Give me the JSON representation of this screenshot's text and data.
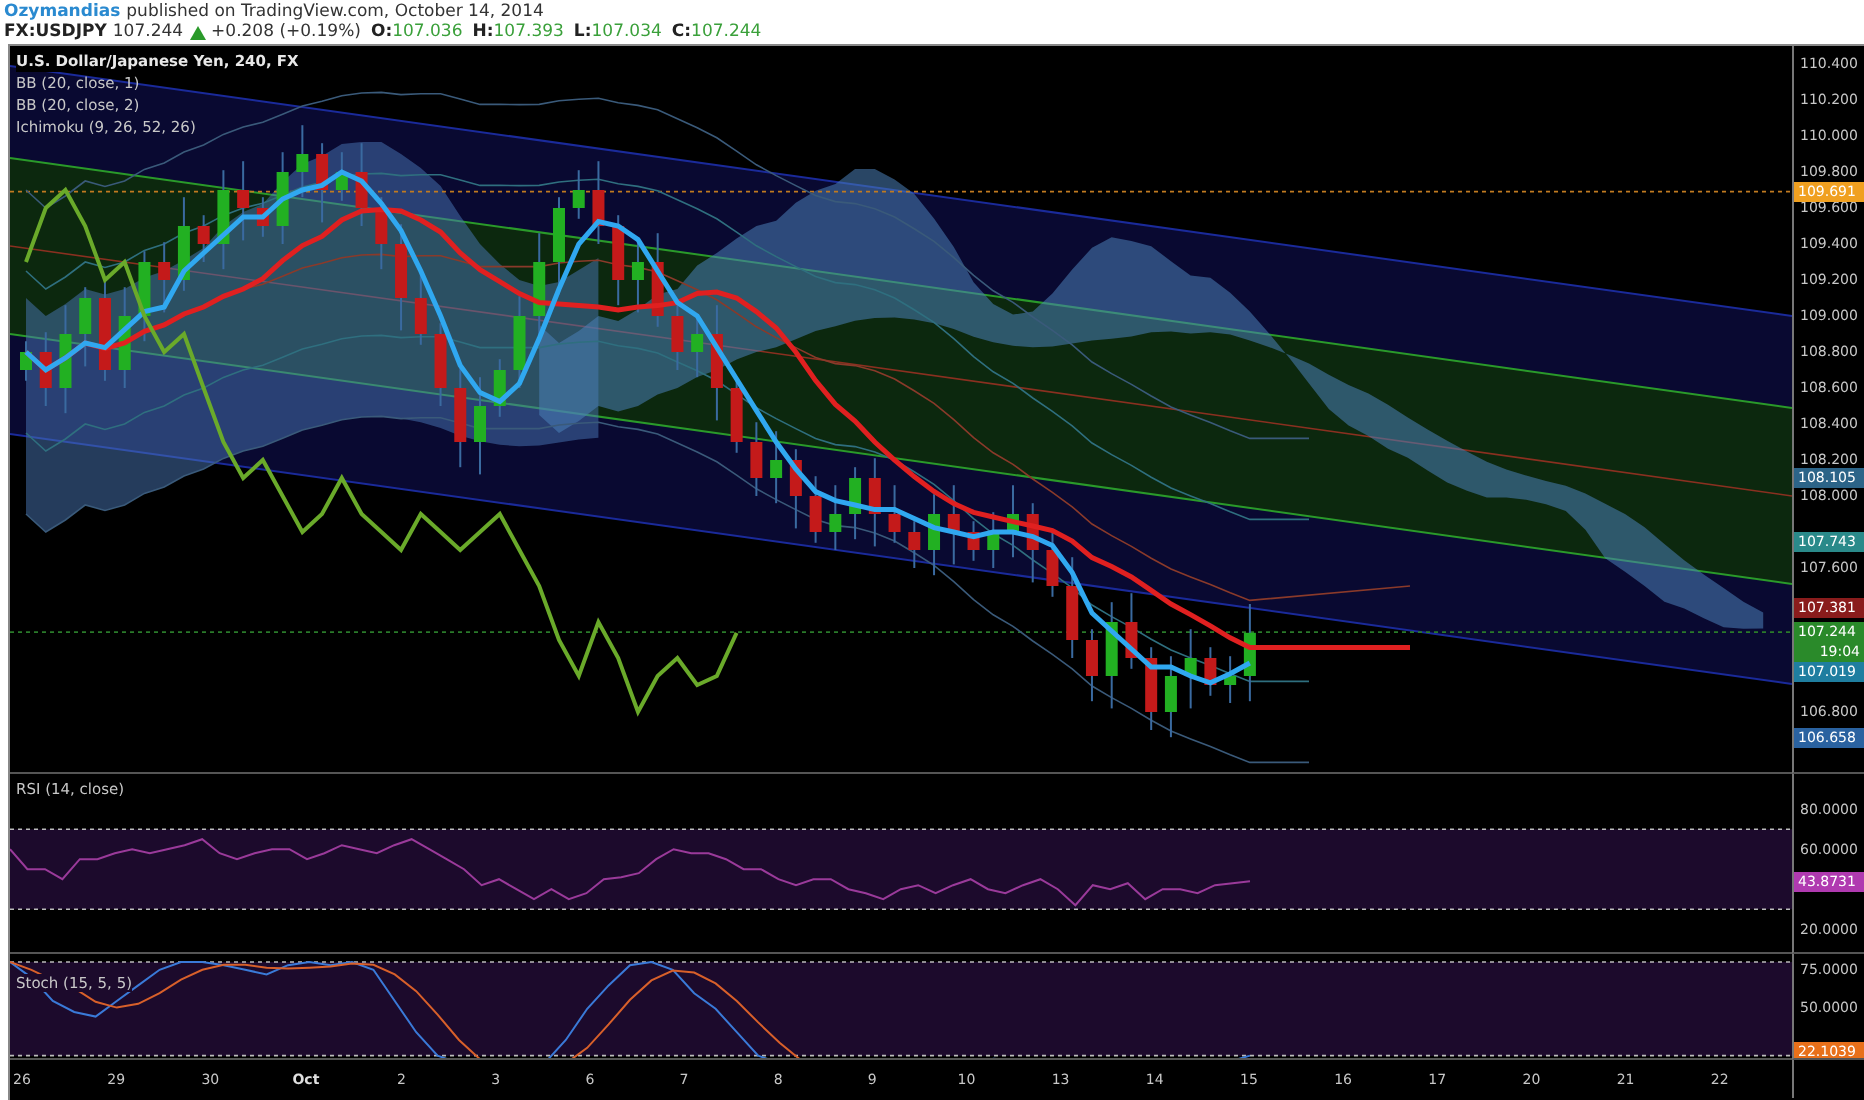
{
  "header": {
    "author": "Ozymandias",
    "published": "published on TradingView.com, October 14, 2014"
  },
  "quote": {
    "symbol": "FX:USDJPY",
    "price": "107.244",
    "rising": true,
    "change": "+0.208 (+0.19%)",
    "ohlc": [
      {
        "label": "O:",
        "value": "107.036"
      },
      {
        "label": "H:",
        "value": "107.393"
      },
      {
        "label": "L:",
        "value": "107.034"
      },
      {
        "label": "C:",
        "value": "107.244"
      }
    ]
  },
  "main_pane": {
    "legend": [
      "U.S. Dollar/Japanese Yen, 240, FX",
      "BB (20, close, 1)",
      "BB (20, close, 2)",
      "Ichimoku (9, 26, 52, 26)"
    ],
    "price_ticks": [
      "110.400",
      "110.200",
      "110.000",
      "109.800",
      "109.600",
      "109.400",
      "109.200",
      "109.000",
      "108.800",
      "108.600",
      "108.400",
      "108.200",
      "108.000",
      "107.600",
      "106.800"
    ],
    "price_badges": [
      {
        "text": "109.691",
        "color": "#f0a020"
      },
      {
        "text": "108.105",
        "color": "#2c6488"
      },
      {
        "text": "107.743",
        "color": "#2a8a8a"
      },
      {
        "text": "107.381",
        "color": "#8a1c1c"
      },
      {
        "text": "107.244",
        "color": "#2a8a2a",
        "countdown": "19:04"
      },
      {
        "text": "107.019",
        "color": "#1f7ea0"
      },
      {
        "text": "106.658",
        "color": "#2a62a0"
      }
    ]
  },
  "rsi_pane": {
    "title": "RSI (14, close)",
    "ticks": [
      "80.0000",
      "60.0000",
      "20.0000"
    ],
    "badge": {
      "text": "43.8731",
      "color": "#b03ab0"
    }
  },
  "stoch_pane": {
    "title": "Stoch (15, 5, 5)",
    "ticks": [
      "75.0000",
      "50.0000"
    ],
    "badge": {
      "text": "22.1039",
      "color": "#e8701a"
    }
  },
  "time_axis": [
    {
      "label": "26",
      "kind": "day"
    },
    {
      "label": "29",
      "kind": "day"
    },
    {
      "label": "30",
      "kind": "day"
    },
    {
      "label": "Oct",
      "kind": "month"
    },
    {
      "label": "2",
      "kind": "day"
    },
    {
      "label": "3",
      "kind": "day"
    },
    {
      "label": "6",
      "kind": "day"
    },
    {
      "label": "7",
      "kind": "day"
    },
    {
      "label": "8",
      "kind": "day"
    },
    {
      "label": "9",
      "kind": "day"
    },
    {
      "label": "10",
      "kind": "day"
    },
    {
      "label": "13",
      "kind": "day"
    },
    {
      "label": "14",
      "kind": "day"
    },
    {
      "label": "15",
      "kind": "day"
    },
    {
      "label": "16",
      "kind": "day"
    },
    {
      "label": "17",
      "kind": "day"
    },
    {
      "label": "20",
      "kind": "day"
    },
    {
      "label": "21",
      "kind": "day"
    },
    {
      "label": "22",
      "kind": "day"
    }
  ]
}
